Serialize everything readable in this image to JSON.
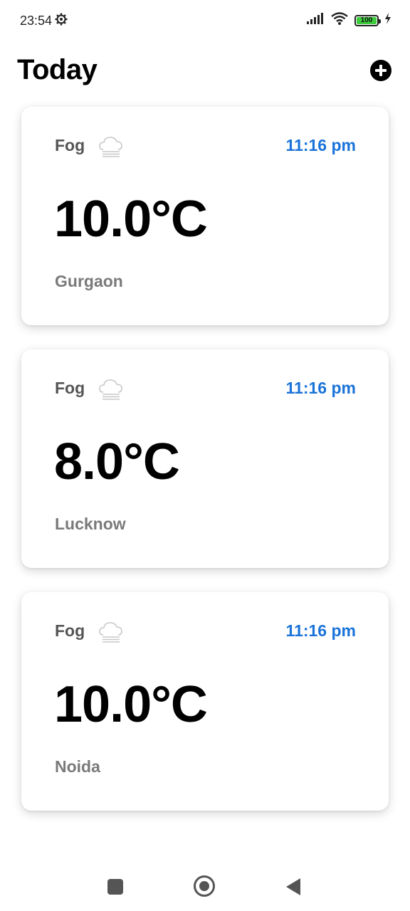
{
  "status_bar": {
    "time": "23:54",
    "battery": "100",
    "battery_level": 1.0,
    "icons": [
      "settings-gear-icon",
      "signal-icon",
      "wifi-icon",
      "battery-icon",
      "charging-bolt-icon"
    ]
  },
  "header": {
    "title": "Today",
    "add_icon": "add-circle-icon"
  },
  "cards": [
    {
      "condition": "Fog",
      "icon": "fog-cloud-icon",
      "time": "11:16 pm",
      "temperature": "10.0°C",
      "city": "Gurgaon"
    },
    {
      "condition": "Fog",
      "icon": "fog-cloud-icon",
      "time": "11:16 pm",
      "temperature": "8.0°C",
      "city": "Lucknow"
    },
    {
      "condition": "Fog",
      "icon": "fog-cloud-icon",
      "time": "11:16 pm",
      "temperature": "10.0°C",
      "city": "Noida"
    }
  ],
  "nav_bar": {
    "buttons": [
      "recents-square-icon",
      "home-circle-icon",
      "back-triangle-icon"
    ]
  },
  "colors": {
    "time_accent": "#1a73d9",
    "condition_text": "#555555",
    "city_text": "#7a7a7a",
    "battery_fill": "#3ccc3c"
  }
}
